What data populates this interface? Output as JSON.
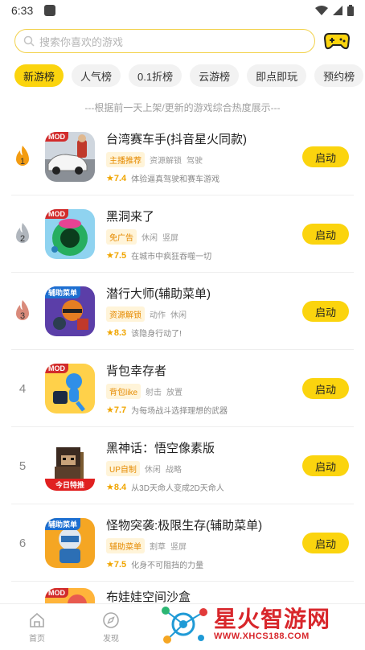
{
  "status": {
    "time": "6:33"
  },
  "search": {
    "placeholder": "搜索你喜欢的游戏"
  },
  "tabs": [
    {
      "label": "新游榜",
      "active": true
    },
    {
      "label": "人气榜",
      "active": false
    },
    {
      "label": "0.1折榜",
      "active": false
    },
    {
      "label": "云游榜",
      "active": false
    },
    {
      "label": "即点即玩",
      "active": false
    },
    {
      "label": "预约榜",
      "active": false
    }
  ],
  "caption": "---根据前一天上架/更新的游戏综合热度展示---",
  "games": [
    {
      "rank": "1",
      "title": "台湾赛车手(抖音星火同款)",
      "badge": "主播推荐",
      "tags": [
        "资源解锁",
        "驾驶"
      ],
      "score": "7.4",
      "desc": "体验逼真驾驶和赛车游戏",
      "button": "启动",
      "icon_label": "MOD"
    },
    {
      "rank": "2",
      "title": "黑洞来了",
      "badge": "免广告",
      "tags": [
        "休闲",
        "竖屏"
      ],
      "score": "7.5",
      "desc": "在城市中疯狂吞噬一切",
      "button": "启动",
      "icon_label": "MOD"
    },
    {
      "rank": "3",
      "title": "潜行大师(辅助菜单)",
      "badge": "资源解锁",
      "tags": [
        "动作",
        "休闲"
      ],
      "score": "8.3",
      "desc": "该隐身行动了!",
      "button": "启动",
      "icon_label": "辅助菜单"
    },
    {
      "rank": "4",
      "title": "背包幸存者",
      "badge": "背包like",
      "tags": [
        "射击",
        "放置"
      ],
      "score": "7.7",
      "desc": "为每场战斗选择理想的武器",
      "button": "启动",
      "icon_label": "MOD"
    },
    {
      "rank": "5",
      "title": "黑神话：悟空像素版",
      "badge": "UP自制",
      "tags": [
        "休闲",
        "战略"
      ],
      "score": "8.4",
      "desc": "从3D天命人变成2D天命人",
      "button": "启动",
      "icon_bottom": "今日特推"
    },
    {
      "rank": "6",
      "title": "怪物突袭:极限生存(辅助菜单)",
      "badge": "辅助菜单",
      "tags": [
        "割草",
        "竖屏"
      ],
      "score": "7.5",
      "desc": "化身不可阻挡的力量",
      "button": "启动",
      "icon_label": "辅助菜单"
    },
    {
      "title": "布娃娃空间沙盒",
      "icon_label": "MOD"
    }
  ],
  "nav": [
    {
      "label": "首页",
      "icon": "home-icon"
    },
    {
      "label": "发现",
      "icon": "compass-icon"
    }
  ],
  "watermark": {
    "title": "星火智游网",
    "url": "WWW.XHCS188.COM"
  },
  "colors": {
    "accent": "#fbd40e",
    "badge_text": "#e58a00",
    "score": "#f0a500",
    "watermark": "#d8262b"
  }
}
